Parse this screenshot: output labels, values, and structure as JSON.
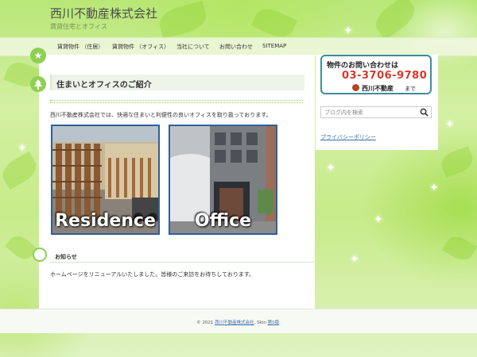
{
  "site": {
    "title": "西川不動産株式会社",
    "description": "賃貸住宅とオフィス"
  },
  "nav": {
    "items": [
      {
        "label": "賃貸物件 （住居）"
      },
      {
        "label": "賃貸物件 （オフィス）"
      },
      {
        "label": "当社について"
      },
      {
        "label": "お問い合わせ"
      },
      {
        "label": "SITEMAP"
      }
    ]
  },
  "main": {
    "section_title": "住まいとオフィスのご紹介",
    "intro": "西川不動産株式会社では、快適な住まいと利便性の良いオフィスを取り扱っております。",
    "photos": [
      {
        "label": "Residence"
      },
      {
        "label": "Office"
      }
    ],
    "news": {
      "title": "お知らせ",
      "text": "ホームページをリニューアルいたしました。皆様のご来訪をお待ちしております。"
    }
  },
  "sidebar": {
    "contact": {
      "line1": "物件のお問い合わせは",
      "phone": "03-3706-9780",
      "company": "西川不動産",
      "suffix": "まで"
    },
    "search": {
      "placeholder": "ブログ内を検索"
    },
    "privacy_link": "プライバシーポリシー"
  },
  "footer": {
    "prefix": "© 2021",
    "company_link": "西川不動産株式会社",
    "skin_text": ". Skin",
    "skin_link": "第0版",
    "end": "."
  },
  "colors": {
    "accent_green": "#8fcf52",
    "phone_red": "#d33a2c",
    "link_blue": "#3c6ca8",
    "banner_border": "#3a8f9a"
  },
  "icons": {
    "star": "star-icon",
    "tree": "tree-icon",
    "search": "search-icon"
  }
}
